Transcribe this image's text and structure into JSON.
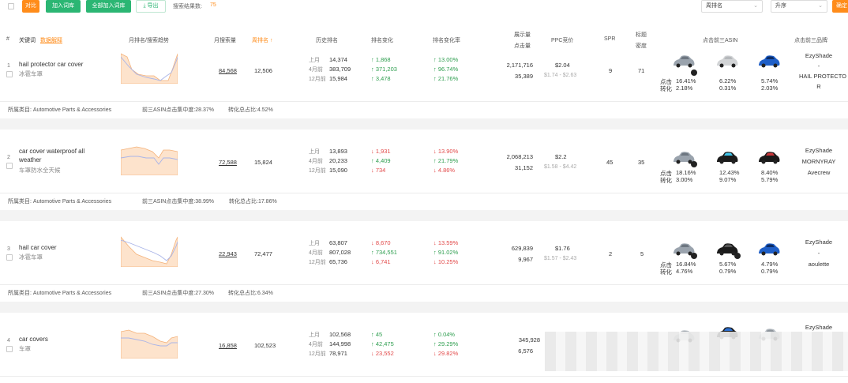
{
  "toolbar": {
    "compare": "对比",
    "add_to_library": "加入词库",
    "add_all_to_library": "全部加入词库",
    "export": "导出",
    "result_count_label": "搜索结果数:",
    "result_count": "75",
    "sort_by": "周排名",
    "sort_order": "升序",
    "confirm": "确定"
  },
  "columns": {
    "index": "#",
    "keyword": "关键词",
    "data_explain": "数据解释",
    "trend": "月排名/搜索趋势",
    "monthly_search": "月搜索量",
    "weekly_rank": "周排名 ↑",
    "history_rank": "历史排名",
    "rank_change": "排名变化",
    "rank_change_rate": "排名变化率",
    "impressions": "展示量",
    "clicks": "点击量",
    "ppc": "PPC竞价",
    "spr": "SPR",
    "title_density_1": "标题",
    "title_density_2": "密度",
    "top3_asin": "点击前三ASIN",
    "top3_brand": "点击前三品牌"
  },
  "history_labels": [
    "上月",
    "4月前",
    "12月前"
  ],
  "row_labels": {
    "click": "点击",
    "conversion": "转化"
  },
  "rows": [
    {
      "index": "1",
      "keyword": "hail protector car cover",
      "keyword_cn": "冰雹车罩",
      "monthly_search": "84,568",
      "weekly_rank": "12,506",
      "history": [
        "14,374",
        "383,709",
        "15,984"
      ],
      "changes": [
        {
          "t": "↑ 1,868",
          "d": "up"
        },
        {
          "t": "↑ 371,203",
          "d": "up"
        },
        {
          "t": "↑ 3,478",
          "d": "up"
        }
      ],
      "rates": [
        {
          "t": "↑ 13.00%",
          "d": "up"
        },
        {
          "t": "↑ 96.74%",
          "d": "up"
        },
        {
          "t": "↑ 21.76%",
          "d": "up"
        }
      ],
      "impressions": "2,171,716",
      "clicks": "35,389",
      "ppc": "$2.04",
      "ppc_range": "$1.74 - $2.63",
      "spr": "9",
      "title_density": "71",
      "asin_click": [
        "16.41%",
        "6.22%",
        "5.74%"
      ],
      "asin_conv": [
        "2.18%",
        "0.31%",
        "2.03%"
      ],
      "brands": [
        "EzyShade",
        "-",
        "HAIL PROTECTO",
        "R"
      ],
      "category_label": "所属类目: Automotive Parts & Accessories",
      "top3_concentration": "前三ASIN点击集中度:28.37%",
      "conversion_share": "转化总占比:4.52%"
    },
    {
      "index": "2",
      "keyword": "car cover waterproof all weather",
      "keyword_cn": "车罩防水全天候",
      "monthly_search": "72,588",
      "weekly_rank": "15,824",
      "history": [
        "13,893",
        "20,233",
        "15,090"
      ],
      "changes": [
        {
          "t": "↓ 1,931",
          "d": "down"
        },
        {
          "t": "↑ 4,409",
          "d": "up"
        },
        {
          "t": "↓ 734",
          "d": "down"
        }
      ],
      "rates": [
        {
          "t": "↓ 13.90%",
          "d": "down"
        },
        {
          "t": "↑ 21.79%",
          "d": "up"
        },
        {
          "t": "↓ 4.86%",
          "d": "down"
        }
      ],
      "impressions": "2,068,213",
      "clicks": "31,152",
      "ppc": "$2.2",
      "ppc_range": "$1.58 - $4.42",
      "spr": "45",
      "title_density": "35",
      "asin_click": [
        "18.16%",
        "12.43%",
        "8.40%"
      ],
      "asin_conv": [
        "3.00%",
        "9.07%",
        "5.79%"
      ],
      "brands": [
        "EzyShade",
        "MORNYRAY",
        "Avecrew"
      ],
      "category_label": "所属类目: Automotive Parts & Accessories",
      "top3_concentration": "前三ASIN点击集中度:38.99%",
      "conversion_share": "转化总占比:17.86%"
    },
    {
      "index": "3",
      "keyword": "hail car cover",
      "keyword_cn": "冰雹车罩",
      "monthly_search": "22,943",
      "weekly_rank": "72,477",
      "history": [
        "63,807",
        "807,028",
        "65,736"
      ],
      "changes": [
        {
          "t": "↓ 8,670",
          "d": "down"
        },
        {
          "t": "↑ 734,551",
          "d": "up"
        },
        {
          "t": "↓ 6,741",
          "d": "down"
        }
      ],
      "rates": [
        {
          "t": "↓ 13.59%",
          "d": "down"
        },
        {
          "t": "↑ 91.02%",
          "d": "up"
        },
        {
          "t": "↓ 10.25%",
          "d": "down"
        }
      ],
      "impressions": "629,839",
      "clicks": "9,967",
      "ppc": "$1.76",
      "ppc_range": "$1.57 - $2.43",
      "spr": "2",
      "title_density": "5",
      "asin_click": [
        "16.84%",
        "5.67%",
        "4.79%"
      ],
      "asin_conv": [
        "4.76%",
        "0.79%",
        "0.79%"
      ],
      "brands": [
        "EzyShade",
        "-",
        "aoulette"
      ],
      "category_label": "所属类目: Automotive Parts & Accessories",
      "top3_concentration": "前三ASIN点击集中度:27.30%",
      "conversion_share": "转化总占比:6.34%"
    },
    {
      "index": "4",
      "keyword": "car covers",
      "keyword_cn": "车罩",
      "monthly_search": "16,858",
      "weekly_rank": "102,523",
      "history": [
        "102,568",
        "144,998",
        "78,971"
      ],
      "changes": [
        {
          "t": "↑ 45",
          "d": "up"
        },
        {
          "t": "↑ 42,475",
          "d": "up"
        },
        {
          "t": "↓ 23,552",
          "d": "down"
        }
      ],
      "rates": [
        {
          "t": "↑ 0.04%",
          "d": "up"
        },
        {
          "t": "↑ 29.29%",
          "d": "up"
        },
        {
          "t": "↓ 29.82%",
          "d": "down"
        }
      ],
      "impressions": "345,928",
      "clicks": "6,576",
      "brands": [
        "EzyShade"
      ]
    }
  ],
  "colors": {
    "accent_orange": "#ff8c1a",
    "accent_green": "#2bb673",
    "up": "#2e9e4f",
    "down": "#e24a4a",
    "trend_fill": "#fde3cc",
    "trend_line": "#f4b27a",
    "search_line": "#a9b4e8"
  }
}
